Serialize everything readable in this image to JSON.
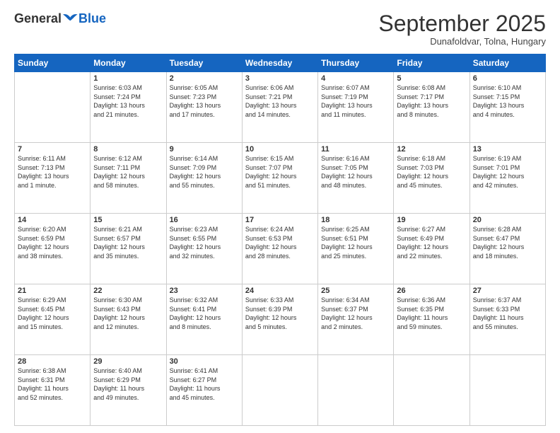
{
  "logo": {
    "general": "General",
    "blue": "Blue"
  },
  "header": {
    "title": "September 2025",
    "location": "Dunafoldvar, Tolna, Hungary"
  },
  "days_of_week": [
    "Sunday",
    "Monday",
    "Tuesday",
    "Wednesday",
    "Thursday",
    "Friday",
    "Saturday"
  ],
  "weeks": [
    [
      {
        "day": "",
        "info": ""
      },
      {
        "day": "1",
        "info": "Sunrise: 6:03 AM\nSunset: 7:24 PM\nDaylight: 13 hours\nand 21 minutes."
      },
      {
        "day": "2",
        "info": "Sunrise: 6:05 AM\nSunset: 7:23 PM\nDaylight: 13 hours\nand 17 minutes."
      },
      {
        "day": "3",
        "info": "Sunrise: 6:06 AM\nSunset: 7:21 PM\nDaylight: 13 hours\nand 14 minutes."
      },
      {
        "day": "4",
        "info": "Sunrise: 6:07 AM\nSunset: 7:19 PM\nDaylight: 13 hours\nand 11 minutes."
      },
      {
        "day": "5",
        "info": "Sunrise: 6:08 AM\nSunset: 7:17 PM\nDaylight: 13 hours\nand 8 minutes."
      },
      {
        "day": "6",
        "info": "Sunrise: 6:10 AM\nSunset: 7:15 PM\nDaylight: 13 hours\nand 4 minutes."
      }
    ],
    [
      {
        "day": "7",
        "info": "Sunrise: 6:11 AM\nSunset: 7:13 PM\nDaylight: 13 hours\nand 1 minute."
      },
      {
        "day": "8",
        "info": "Sunrise: 6:12 AM\nSunset: 7:11 PM\nDaylight: 12 hours\nand 58 minutes."
      },
      {
        "day": "9",
        "info": "Sunrise: 6:14 AM\nSunset: 7:09 PM\nDaylight: 12 hours\nand 55 minutes."
      },
      {
        "day": "10",
        "info": "Sunrise: 6:15 AM\nSunset: 7:07 PM\nDaylight: 12 hours\nand 51 minutes."
      },
      {
        "day": "11",
        "info": "Sunrise: 6:16 AM\nSunset: 7:05 PM\nDaylight: 12 hours\nand 48 minutes."
      },
      {
        "day": "12",
        "info": "Sunrise: 6:18 AM\nSunset: 7:03 PM\nDaylight: 12 hours\nand 45 minutes."
      },
      {
        "day": "13",
        "info": "Sunrise: 6:19 AM\nSunset: 7:01 PM\nDaylight: 12 hours\nand 42 minutes."
      }
    ],
    [
      {
        "day": "14",
        "info": "Sunrise: 6:20 AM\nSunset: 6:59 PM\nDaylight: 12 hours\nand 38 minutes."
      },
      {
        "day": "15",
        "info": "Sunrise: 6:21 AM\nSunset: 6:57 PM\nDaylight: 12 hours\nand 35 minutes."
      },
      {
        "day": "16",
        "info": "Sunrise: 6:23 AM\nSunset: 6:55 PM\nDaylight: 12 hours\nand 32 minutes."
      },
      {
        "day": "17",
        "info": "Sunrise: 6:24 AM\nSunset: 6:53 PM\nDaylight: 12 hours\nand 28 minutes."
      },
      {
        "day": "18",
        "info": "Sunrise: 6:25 AM\nSunset: 6:51 PM\nDaylight: 12 hours\nand 25 minutes."
      },
      {
        "day": "19",
        "info": "Sunrise: 6:27 AM\nSunset: 6:49 PM\nDaylight: 12 hours\nand 22 minutes."
      },
      {
        "day": "20",
        "info": "Sunrise: 6:28 AM\nSunset: 6:47 PM\nDaylight: 12 hours\nand 18 minutes."
      }
    ],
    [
      {
        "day": "21",
        "info": "Sunrise: 6:29 AM\nSunset: 6:45 PM\nDaylight: 12 hours\nand 15 minutes."
      },
      {
        "day": "22",
        "info": "Sunrise: 6:30 AM\nSunset: 6:43 PM\nDaylight: 12 hours\nand 12 minutes."
      },
      {
        "day": "23",
        "info": "Sunrise: 6:32 AM\nSunset: 6:41 PM\nDaylight: 12 hours\nand 8 minutes."
      },
      {
        "day": "24",
        "info": "Sunrise: 6:33 AM\nSunset: 6:39 PM\nDaylight: 12 hours\nand 5 minutes."
      },
      {
        "day": "25",
        "info": "Sunrise: 6:34 AM\nSunset: 6:37 PM\nDaylight: 12 hours\nand 2 minutes."
      },
      {
        "day": "26",
        "info": "Sunrise: 6:36 AM\nSunset: 6:35 PM\nDaylight: 11 hours\nand 59 minutes."
      },
      {
        "day": "27",
        "info": "Sunrise: 6:37 AM\nSunset: 6:33 PM\nDaylight: 11 hours\nand 55 minutes."
      }
    ],
    [
      {
        "day": "28",
        "info": "Sunrise: 6:38 AM\nSunset: 6:31 PM\nDaylight: 11 hours\nand 52 minutes."
      },
      {
        "day": "29",
        "info": "Sunrise: 6:40 AM\nSunset: 6:29 PM\nDaylight: 11 hours\nand 49 minutes."
      },
      {
        "day": "30",
        "info": "Sunrise: 6:41 AM\nSunset: 6:27 PM\nDaylight: 11 hours\nand 45 minutes."
      },
      {
        "day": "",
        "info": ""
      },
      {
        "day": "",
        "info": ""
      },
      {
        "day": "",
        "info": ""
      },
      {
        "day": "",
        "info": ""
      }
    ]
  ]
}
